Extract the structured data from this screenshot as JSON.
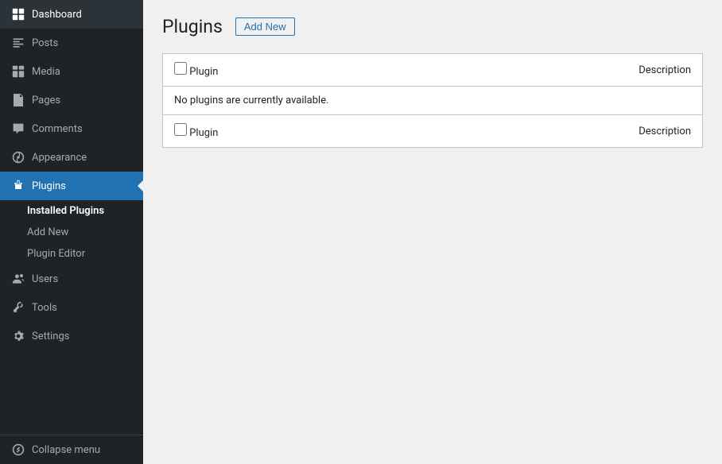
{
  "sidebar": {
    "items": [
      {
        "id": "dashboard",
        "label": "Dashboard",
        "icon": "⊞"
      },
      {
        "id": "posts",
        "label": "Posts",
        "icon": "✎"
      },
      {
        "id": "media",
        "label": "Media",
        "icon": "⊟"
      },
      {
        "id": "pages",
        "label": "Pages",
        "icon": "☰"
      },
      {
        "id": "comments",
        "label": "Comments",
        "icon": "💬"
      },
      {
        "id": "appearance",
        "label": "Appearance",
        "icon": "🎨"
      },
      {
        "id": "plugins",
        "label": "Plugins",
        "icon": "🔌"
      },
      {
        "id": "users",
        "label": "Users",
        "icon": "👤"
      },
      {
        "id": "tools",
        "label": "Tools",
        "icon": "🔧"
      },
      {
        "id": "settings",
        "label": "Settings",
        "icon": "⚙"
      }
    ],
    "plugins_submenu": [
      {
        "id": "installed-plugins",
        "label": "Installed Plugins",
        "active": true
      },
      {
        "id": "add-new",
        "label": "Add New"
      },
      {
        "id": "plugin-editor",
        "label": "Plugin Editor"
      }
    ],
    "collapse_label": "Collapse menu"
  },
  "main": {
    "page_title": "Plugins",
    "add_new_button": "Add New",
    "table": {
      "header_plugin": "Plugin",
      "header_description": "Description",
      "empty_message": "No plugins are currently available.",
      "footer_plugin": "Plugin",
      "footer_description": "Description"
    }
  }
}
